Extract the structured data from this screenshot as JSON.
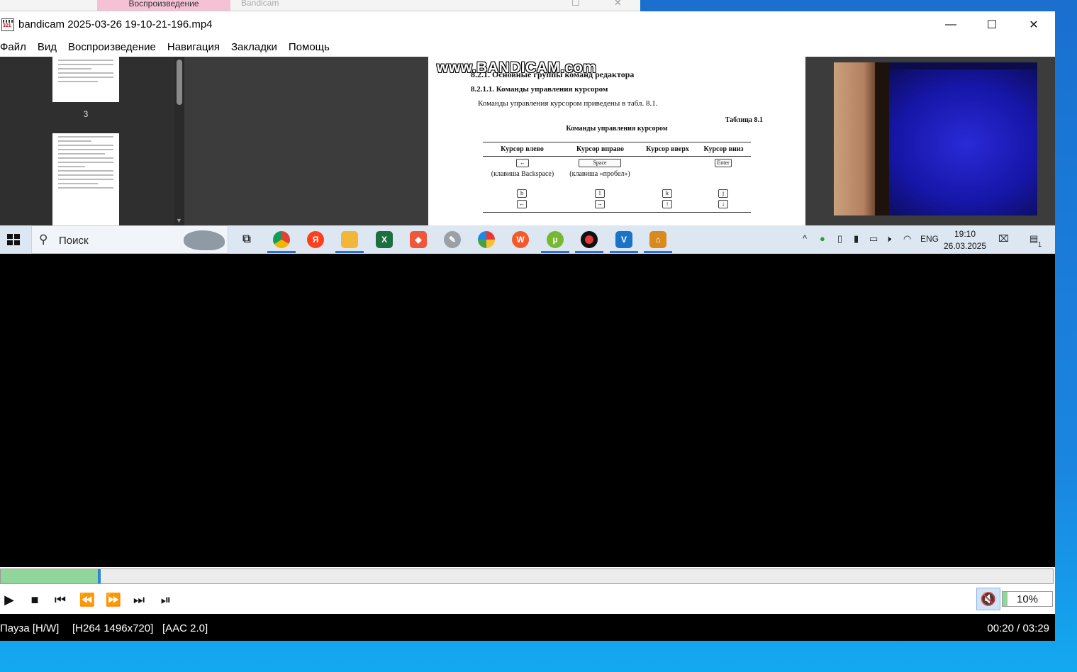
{
  "background_window": {
    "tab_label": "Воспроизведение",
    "title": "Bandicam"
  },
  "window": {
    "title": "bandicam 2025-03-26 19-10-21-196.mp4",
    "minimize": "—",
    "maximize": "☐",
    "close": "✕"
  },
  "menu": [
    "Файл",
    "Вид",
    "Воспроизведение",
    "Навигация",
    "Закладки",
    "Помощь"
  ],
  "video_frame": {
    "thumb_page_number": "3",
    "watermark": "www.BANDICAM.com",
    "heading1": "8.2.1.   Основные группы команд редактора",
    "heading2": "8.2.1.1.   Команды управления курсором",
    "paragraph": "Команды управления курсором приведены в табл. 8.1.",
    "table_label": "Таблица 8.1",
    "table_caption": "Команды управления курсором",
    "columns": [
      "Курсор влево",
      "Курсор вправо",
      "Курсор вверх",
      "Курсор вниз"
    ],
    "row1_keys": [
      "←",
      "Space",
      "",
      "Enter"
    ],
    "row1_notes": [
      "(клавиша Backspace)",
      "(клавиша «пробел»)"
    ],
    "row2_keys": [
      "h",
      "l",
      "k",
      "j"
    ],
    "row3_keys": [
      "←",
      "→",
      "↑",
      "↓"
    ],
    "taskbar": {
      "search_placeholder": "Поиск",
      "lang": "ENG",
      "time": "19:10",
      "date": "26.03.2025",
      "notification_count": "1"
    }
  },
  "playback": {
    "progress_fraction": 0.092,
    "volume": "10%",
    "volume_fraction": 0.1
  },
  "status": {
    "state": "Пауза [H/W]",
    "video_codec": "[H264 1496x720]",
    "audio_codec": "[AAC 2.0]",
    "time": "00:20 / 03:29"
  },
  "colors": {
    "progress_fill": "#90d69a",
    "progress_handle": "#2b83d9",
    "desktop": "#1a86e0"
  }
}
